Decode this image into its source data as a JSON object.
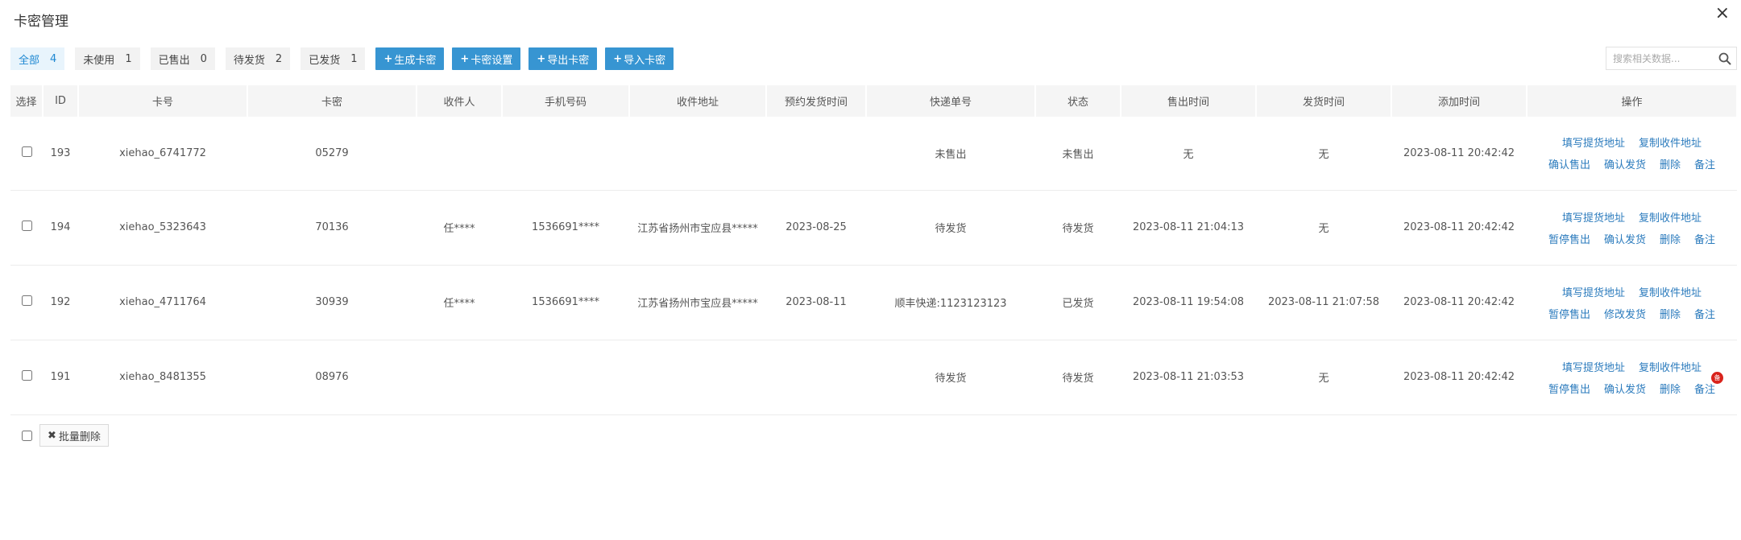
{
  "window": {
    "title": "卡密管理",
    "close_glyph": "×"
  },
  "filters": [
    {
      "label": "全部",
      "count": "4",
      "active": true
    },
    {
      "label": "未使用",
      "count": "1"
    },
    {
      "label": "已售出",
      "count": "0"
    },
    {
      "label": "待发货",
      "count": "2"
    },
    {
      "label": "已发货",
      "count": "1"
    }
  ],
  "actions": {
    "generate": "生成卡密",
    "settings": "卡密设置",
    "export": "导出卡密",
    "import": "导入卡密"
  },
  "search": {
    "placeholder": "搜索相关数据..."
  },
  "table": {
    "columns": [
      "选择",
      "ID",
      "卡号",
      "卡密",
      "收件人",
      "手机号码",
      "收件地址",
      "预约发货时间",
      "快递单号",
      "状态",
      "售出时间",
      "发货时间",
      "添加时间",
      "操作"
    ],
    "rows": [
      {
        "id": "193",
        "card_no": "xiehao_6741772",
        "secret": "05279",
        "recipient": "",
        "phone": "",
        "address": "",
        "scheduled": "",
        "tracking": "未售出",
        "status": "未售出",
        "sold_time": "无",
        "ship_time": "无",
        "added_time": "2023-08-11 20:42:42",
        "ops_line1": [
          "填写提货地址",
          "复制收件地址"
        ],
        "ops_line2": [
          "确认售出",
          "确认发货",
          "删除",
          "备注"
        ]
      },
      {
        "id": "194",
        "card_no": "xiehao_5323643",
        "secret": "70136",
        "recipient": "任****",
        "phone": "1536691****",
        "address": "江苏省扬州市宝应县*****",
        "scheduled": "2023-08-25",
        "tracking": "待发货",
        "status": "待发货",
        "sold_time": "2023-08-11 21:04:13",
        "ship_time": "无",
        "added_time": "2023-08-11 20:42:42",
        "ops_line1": [
          "填写提货地址",
          "复制收件地址"
        ],
        "ops_line2": [
          "暂停售出",
          "确认发货",
          "删除",
          "备注"
        ]
      },
      {
        "id": "192",
        "card_no": "xiehao_4711764",
        "secret": "30939",
        "recipient": "任****",
        "phone": "1536691****",
        "address": "江苏省扬州市宝应县*****",
        "scheduled": "2023-08-11",
        "tracking": "顺丰快递:1123123123",
        "status": "已发货",
        "sold_time": "2023-08-11 19:54:08",
        "ship_time": "2023-08-11 21:07:58",
        "added_time": "2023-08-11 20:42:42",
        "ops_line1": [
          "填写提货地址",
          "复制收件地址"
        ],
        "ops_line2": [
          "暂停售出",
          "修改发货",
          "删除",
          "备注"
        ]
      },
      {
        "id": "191",
        "card_no": "xiehao_8481355",
        "secret": "08976",
        "recipient": "",
        "phone": "",
        "address": "",
        "scheduled": "",
        "tracking": "待发货",
        "status": "待发货",
        "sold_time": "2023-08-11 21:03:53",
        "ship_time": "无",
        "added_time": "2023-08-11 20:42:42",
        "ops_line1": [
          "填写提货地址",
          "复制收件地址"
        ],
        "ops_line2": [
          "暂停售出",
          "确认发货",
          "删除",
          "备注"
        ],
        "note_badge": "备"
      }
    ]
  },
  "footer": {
    "batch_delete": "批量删除"
  },
  "colors": {
    "primary": "#3795d2",
    "pending": "#d9231c",
    "shipped": "#2b3fb5",
    "link": "#2b7bbd"
  }
}
